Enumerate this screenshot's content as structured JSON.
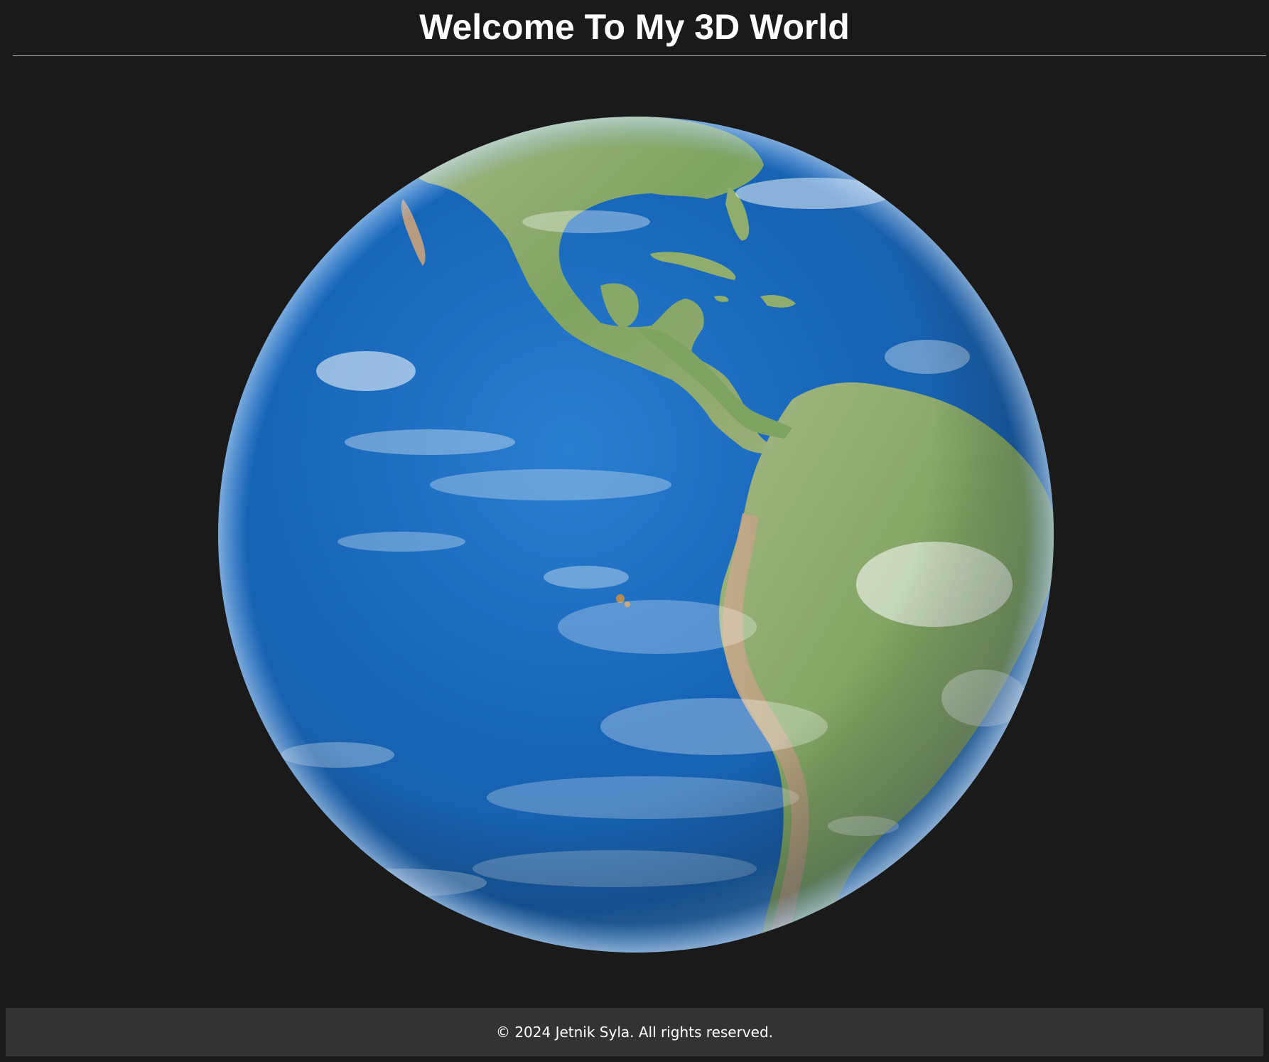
{
  "header": {
    "title": "Welcome To My 3D World"
  },
  "scene": {
    "model_icon": "earth-globe-icon",
    "background_color": "#1a1a1a",
    "ocean_color": "#1565b8",
    "land_color": "#8fae6e"
  },
  "footer": {
    "copyright": "© 2024 Jetnik Syla. All rights reserved.",
    "background_color": "#333333"
  }
}
